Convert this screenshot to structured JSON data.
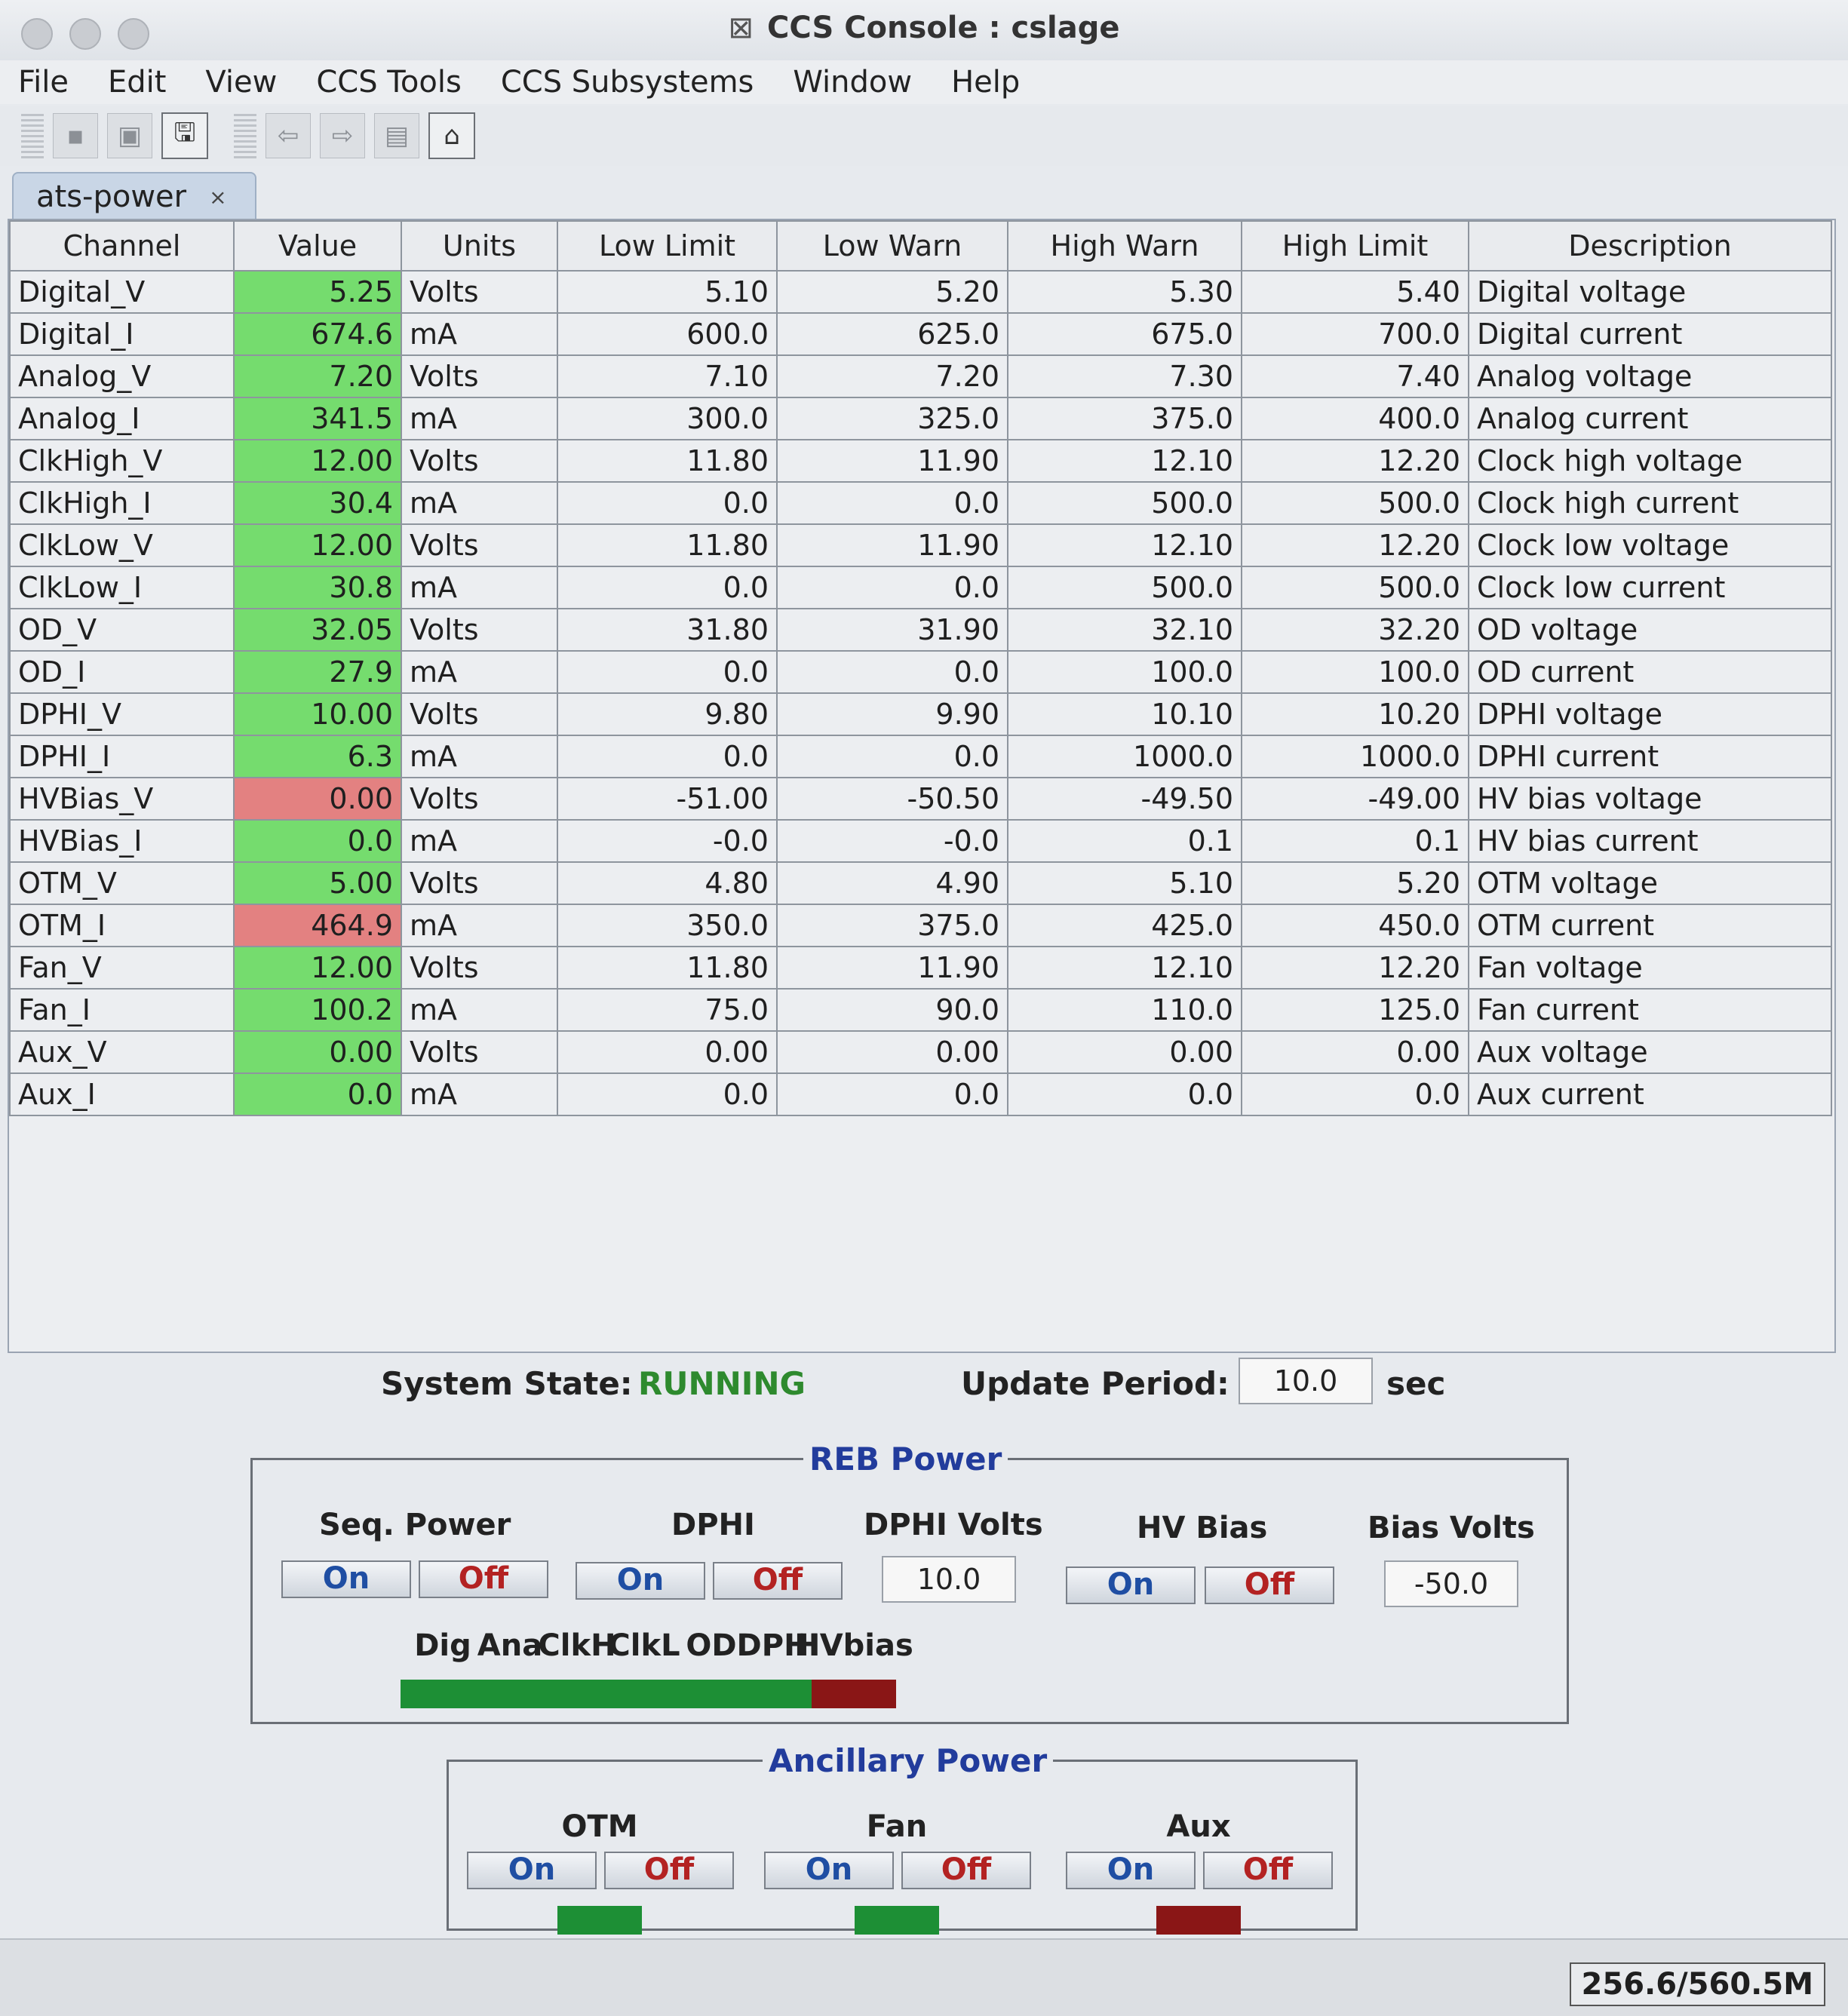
{
  "window": {
    "title": "CCS Console : cslage"
  },
  "menu": [
    {
      "label": "File"
    },
    {
      "label": "Edit"
    },
    {
      "label": "View"
    },
    {
      "label": "CCS Tools"
    },
    {
      "label": "CCS Subsystems"
    },
    {
      "label": "Window"
    },
    {
      "label": "Help"
    }
  ],
  "toolbar": {
    "icons": [
      "save-icon",
      "save-all-icon",
      "save-as-icon",
      "back-arrow-icon",
      "forward-arrow-icon",
      "page-icon",
      "home-icon"
    ]
  },
  "tab": {
    "title": "ats-power",
    "close": "×"
  },
  "table": {
    "headers": [
      "Channel",
      "Value",
      "Units",
      "Low Limit",
      "Low Warn",
      "High Warn",
      "High Limit",
      "Description"
    ],
    "rows": [
      {
        "channel": "Digital_V",
        "value": "5.25",
        "units": "Volts",
        "low_limit": "5.10",
        "low_warn": "5.20",
        "high_warn": "5.30",
        "high_limit": "5.40",
        "description": "Digital voltage",
        "status": "ok"
      },
      {
        "channel": "Digital_I",
        "value": "674.6",
        "units": "mA",
        "low_limit": "600.0",
        "low_warn": "625.0",
        "high_warn": "675.0",
        "high_limit": "700.0",
        "description": "Digital current",
        "status": "ok"
      },
      {
        "channel": "Analog_V",
        "value": "7.20",
        "units": "Volts",
        "low_limit": "7.10",
        "low_warn": "7.20",
        "high_warn": "7.30",
        "high_limit": "7.40",
        "description": "Analog voltage",
        "status": "ok"
      },
      {
        "channel": "Analog_I",
        "value": "341.5",
        "units": "mA",
        "low_limit": "300.0",
        "low_warn": "325.0",
        "high_warn": "375.0",
        "high_limit": "400.0",
        "description": "Analog current",
        "status": "ok"
      },
      {
        "channel": "ClkHigh_V",
        "value": "12.00",
        "units": "Volts",
        "low_limit": "11.80",
        "low_warn": "11.90",
        "high_warn": "12.10",
        "high_limit": "12.20",
        "description": "Clock high voltage",
        "status": "ok"
      },
      {
        "channel": "ClkHigh_I",
        "value": "30.4",
        "units": "mA",
        "low_limit": "0.0",
        "low_warn": "0.0",
        "high_warn": "500.0",
        "high_limit": "500.0",
        "description": "Clock high current",
        "status": "ok"
      },
      {
        "channel": "ClkLow_V",
        "value": "12.00",
        "units": "Volts",
        "low_limit": "11.80",
        "low_warn": "11.90",
        "high_warn": "12.10",
        "high_limit": "12.20",
        "description": "Clock low voltage",
        "status": "ok"
      },
      {
        "channel": "ClkLow_I",
        "value": "30.8",
        "units": "mA",
        "low_limit": "0.0",
        "low_warn": "0.0",
        "high_warn": "500.0",
        "high_limit": "500.0",
        "description": "Clock low current",
        "status": "ok"
      },
      {
        "channel": "OD_V",
        "value": "32.05",
        "units": "Volts",
        "low_limit": "31.80",
        "low_warn": "31.90",
        "high_warn": "32.10",
        "high_limit": "32.20",
        "description": "OD voltage",
        "status": "ok"
      },
      {
        "channel": "OD_I",
        "value": "27.9",
        "units": "mA",
        "low_limit": "0.0",
        "low_warn": "0.0",
        "high_warn": "100.0",
        "high_limit": "100.0",
        "description": "OD current",
        "status": "ok"
      },
      {
        "channel": "DPHI_V",
        "value": "10.00",
        "units": "Volts",
        "low_limit": "9.80",
        "low_warn": "9.90",
        "high_warn": "10.10",
        "high_limit": "10.20",
        "description": "DPHI voltage",
        "status": "ok"
      },
      {
        "channel": "DPHI_I",
        "value": "6.3",
        "units": "mA",
        "low_limit": "0.0",
        "low_warn": "0.0",
        "high_warn": "1000.0",
        "high_limit": "1000.0",
        "description": "DPHI current",
        "status": "ok"
      },
      {
        "channel": "HVBias_V",
        "value": "0.00",
        "units": "Volts",
        "low_limit": "-51.00",
        "low_warn": "-50.50",
        "high_warn": "-49.50",
        "high_limit": "-49.00",
        "description": "HV bias voltage",
        "status": "bad"
      },
      {
        "channel": "HVBias_I",
        "value": "0.0",
        "units": "mA",
        "low_limit": "-0.0",
        "low_warn": "-0.0",
        "high_warn": "0.1",
        "high_limit": "0.1",
        "description": "HV bias current",
        "status": "ok"
      },
      {
        "channel": "OTM_V",
        "value": "5.00",
        "units": "Volts",
        "low_limit": "4.80",
        "low_warn": "4.90",
        "high_warn": "5.10",
        "high_limit": "5.20",
        "description": "OTM voltage",
        "status": "ok"
      },
      {
        "channel": "OTM_I",
        "value": "464.9",
        "units": "mA",
        "low_limit": "350.0",
        "low_warn": "375.0",
        "high_warn": "425.0",
        "high_limit": "450.0",
        "description": "OTM current",
        "status": "bad"
      },
      {
        "channel": "Fan_V",
        "value": "12.00",
        "units": "Volts",
        "low_limit": "11.80",
        "low_warn": "11.90",
        "high_warn": "12.10",
        "high_limit": "12.20",
        "description": "Fan voltage",
        "status": "ok"
      },
      {
        "channel": "Fan_I",
        "value": "100.2",
        "units": "mA",
        "low_limit": "75.0",
        "low_warn": "90.0",
        "high_warn": "110.0",
        "high_limit": "125.0",
        "description": "Fan current",
        "status": "ok"
      },
      {
        "channel": "Aux_V",
        "value": "0.00",
        "units": "Volts",
        "low_limit": "0.00",
        "low_warn": "0.00",
        "high_warn": "0.00",
        "high_limit": "0.00",
        "description": "Aux voltage",
        "status": "ok"
      },
      {
        "channel": "Aux_I",
        "value": "0.0",
        "units": "mA",
        "low_limit": "0.0",
        "low_warn": "0.0",
        "high_warn": "0.0",
        "high_limit": "0.0",
        "description": "Aux current",
        "status": "ok"
      }
    ]
  },
  "status": {
    "system_state_label": "System State:",
    "system_state": "RUNNING",
    "update_period_label": "Update Period:",
    "update_period": "10.0",
    "update_period_unit": "sec"
  },
  "reb_power": {
    "title": "REB Power",
    "seq_power_label": "Seq. Power",
    "dphi_label": "DPHI",
    "dphi_volts_label": "DPHI Volts",
    "dphi_volts": "10.0",
    "hv_bias_label": "HV Bias",
    "bias_volts_label": "Bias Volts",
    "bias_volts": "-50.0",
    "on_label": "On",
    "off_label": "Off",
    "indicators": [
      {
        "label": "Dig",
        "color": "#1d8f35"
      },
      {
        "label": "Ana",
        "color": "#1d8f35"
      },
      {
        "label": "ClkH",
        "color": "#1d8f35"
      },
      {
        "label": "ClkL",
        "color": "#1d8f35"
      },
      {
        "label": "OD",
        "color": "#1d8f35"
      },
      {
        "label": "DPHI",
        "color": "#1d8f35"
      },
      {
        "label": "HVbias",
        "color": "#8a1616"
      }
    ]
  },
  "ancillary_power": {
    "title": "Ancillary Power",
    "on_label": "On",
    "off_label": "Off",
    "groups": [
      {
        "label": "OTM",
        "color": "#1d8f35"
      },
      {
        "label": "Fan",
        "color": "#1d8f35"
      },
      {
        "label": "Aux",
        "color": "#8a1616"
      }
    ]
  },
  "statusbar": {
    "memory": "256.6/560.5M"
  }
}
